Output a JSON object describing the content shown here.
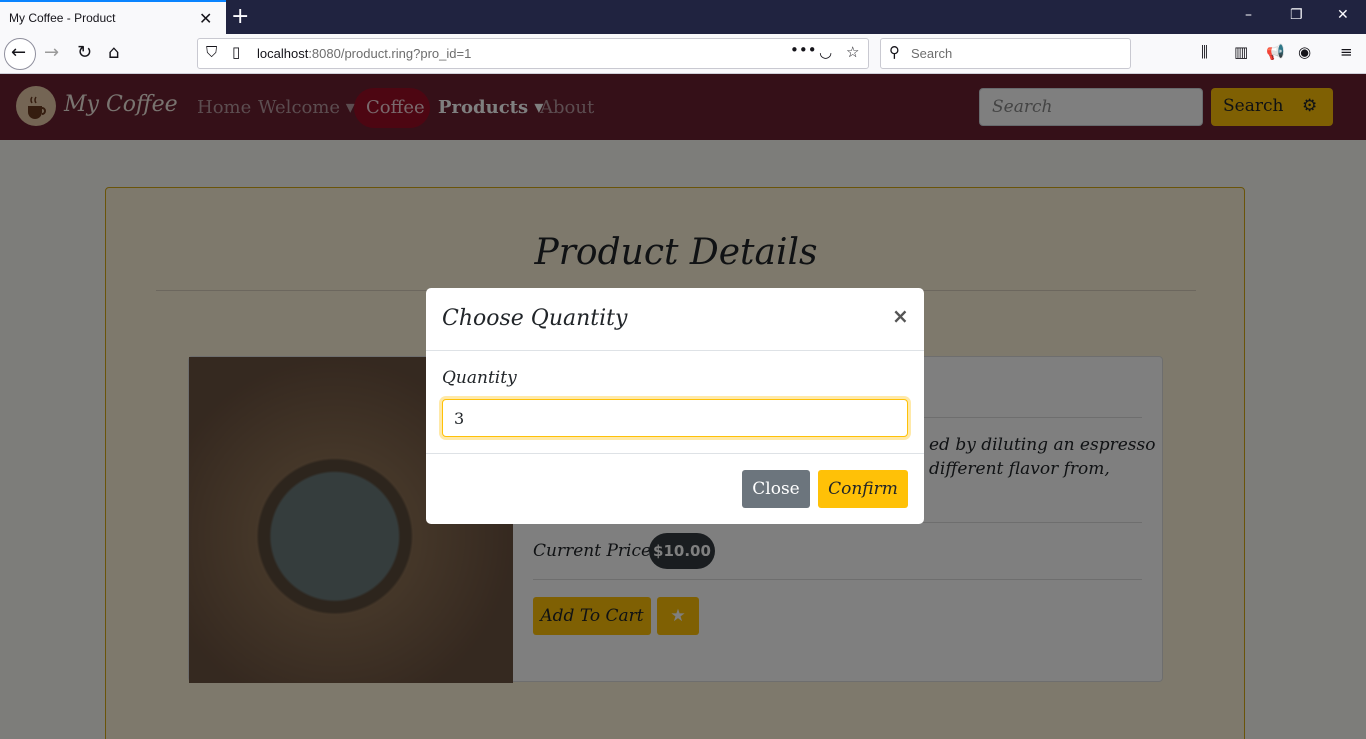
{
  "browser": {
    "tab_title": "My Coffee - Product",
    "tab_close": "✕",
    "new_tab": "+",
    "url_host": "localhost",
    "url_rest": ":8080/product.ring?pro_id=1",
    "search_placeholder": "Search",
    "window_controls": [
      "–",
      "❐",
      "✕"
    ]
  },
  "site": {
    "brand": "My Coffee",
    "menu": {
      "home": "Home",
      "welcome": "Welcome ▾",
      "coffee": "Coffee",
      "products": "Products ▾",
      "about": "About"
    },
    "search_placeholder": "Search",
    "search_button": "Search",
    "search_icon": "⚙"
  },
  "page": {
    "title": "Product Details",
    "description_line1": "ed by diluting an espresso",
    "description_line2": "different flavor from,",
    "price_label": "Current Price:",
    "price": "$10.00",
    "add_to_cart": "Add To Cart",
    "favorite_icon": "★"
  },
  "modal": {
    "title": "Choose Quantity",
    "close_icon": "×",
    "quantity_label": "Quantity",
    "quantity_value": "3",
    "close_button": "Close",
    "confirm_button": "Confirm"
  },
  "colors": {
    "site_nav": "#6b2131",
    "accent": "#ffc107",
    "browser_titlebar": "#202340"
  }
}
